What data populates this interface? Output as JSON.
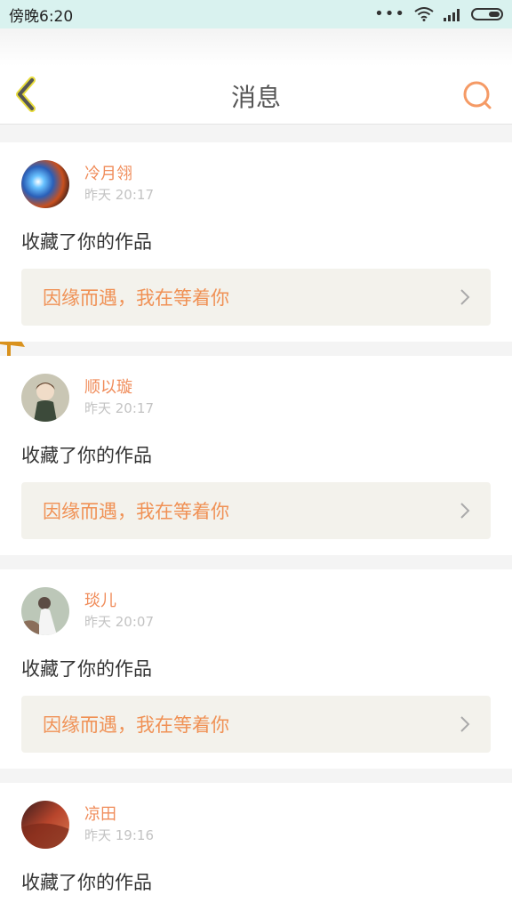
{
  "status_bar": {
    "time": "傍晚6:20",
    "dots": "•••"
  },
  "header": {
    "title": "消息"
  },
  "messages": [
    {
      "username": "冷月翎",
      "time": "昨天 20:17",
      "action": "收藏了你的作品",
      "work_title": "因缘而遇，我在等着你"
    },
    {
      "username": "顺以璇",
      "time": "昨天 20:17",
      "action": "收藏了你的作品",
      "work_title": "因缘而遇，我在等着你"
    },
    {
      "username": "琰儿",
      "time": "昨天 20:07",
      "action": "收藏了你的作品",
      "work_title": "因缘而遇，我在等着你"
    },
    {
      "username": "凉田",
      "time": "昨天 19:16",
      "action": "收藏了你的作品",
      "work_title": ""
    }
  ],
  "colors": {
    "accent": "#f09155",
    "username": "#f08c5a",
    "card_link_bg": "#f3f2ec",
    "status_bg": "#d9f2ef"
  }
}
